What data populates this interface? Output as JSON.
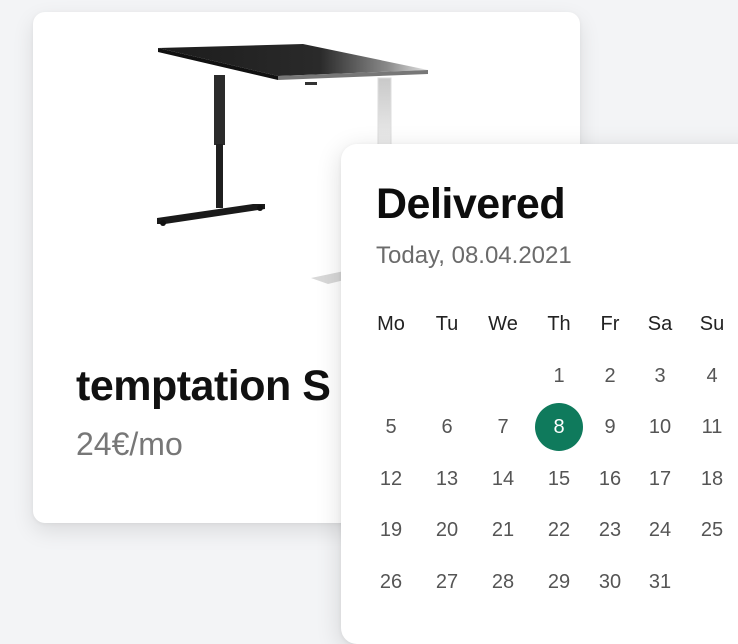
{
  "product": {
    "title": "temptation S",
    "price": "24€/mo"
  },
  "delivery": {
    "title": "Delivered",
    "date": "Today, 08.04.2021",
    "selected_day": "8",
    "accent_color": "#0f7a5c",
    "weekdays": [
      "Mo",
      "Tu",
      "We",
      "Th",
      "Fr",
      "Sa",
      "Su"
    ],
    "weeks": [
      [
        "",
        "",
        "",
        "1",
        "2",
        "3",
        "4"
      ],
      [
        "5",
        "6",
        "7",
        "8",
        "9",
        "10",
        "11"
      ],
      [
        "12",
        "13",
        "14",
        "15",
        "16",
        "17",
        "18"
      ],
      [
        "19",
        "20",
        "21",
        "22",
        "23",
        "24",
        "25"
      ],
      [
        "26",
        "27",
        "28",
        "29",
        "30",
        "31",
        ""
      ]
    ]
  }
}
